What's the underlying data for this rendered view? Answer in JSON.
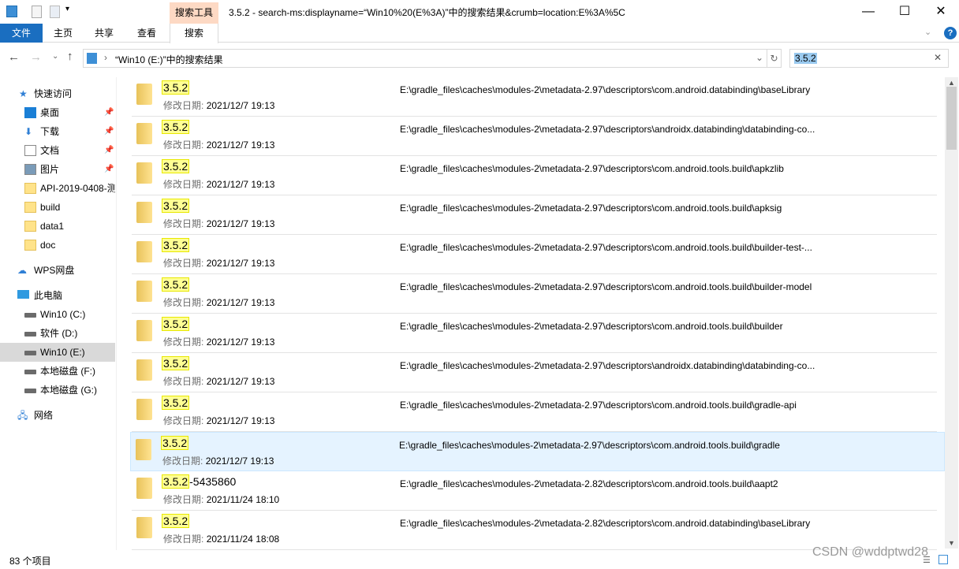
{
  "window": {
    "title": "3.5.2 - search-ms:displayname=“Win10%20(E%3A)”中的搜索结果&crumb=location:E%3A%5C",
    "context_tab": "搜索工具"
  },
  "ribbon": {
    "tabs": [
      "文件",
      "主页",
      "共享",
      "查看",
      "搜索"
    ]
  },
  "address": {
    "path": "“Win10 (E:)”中的搜索结果"
  },
  "search": {
    "value": "3.5.2"
  },
  "nav": {
    "quick_access": "快速访问",
    "items": [
      {
        "label": "桌面",
        "pinned": true
      },
      {
        "label": "下载",
        "pinned": true
      },
      {
        "label": "文档",
        "pinned": true
      },
      {
        "label": "图片",
        "pinned": true
      },
      {
        "label": "API-2019-0408-测"
      },
      {
        "label": "build"
      },
      {
        "label": "data1"
      },
      {
        "label": "doc"
      }
    ],
    "wps": "WPS网盘",
    "pc": "此电脑",
    "drives": [
      "Win10 (C:)",
      "软件 (D:)",
      "Win10 (E:)",
      "本地磁盘 (F:)",
      "本地磁盘 (G:)"
    ],
    "network": "网络"
  },
  "results": {
    "date_label": "修改日期:",
    "rows": [
      {
        "hl": "3.5.2",
        "rest": "",
        "date": "2021/12/7 19:13",
        "path": "E:\\gradle_files\\caches\\modules-2\\metadata-2.97\\descriptors\\com.android.databinding\\baseLibrary"
      },
      {
        "hl": "3.5.2",
        "rest": "",
        "date": "2021/12/7 19:13",
        "path": "E:\\gradle_files\\caches\\modules-2\\metadata-2.97\\descriptors\\androidx.databinding\\databinding-co..."
      },
      {
        "hl": "3.5.2",
        "rest": "",
        "date": "2021/12/7 19:13",
        "path": "E:\\gradle_files\\caches\\modules-2\\metadata-2.97\\descriptors\\com.android.tools.build\\apkzlib"
      },
      {
        "hl": "3.5.2",
        "rest": "",
        "date": "2021/12/7 19:13",
        "path": "E:\\gradle_files\\caches\\modules-2\\metadata-2.97\\descriptors\\com.android.tools.build\\apksig"
      },
      {
        "hl": "3.5.2",
        "rest": "",
        "date": "2021/12/7 19:13",
        "path": "E:\\gradle_files\\caches\\modules-2\\metadata-2.97\\descriptors\\com.android.tools.build\\builder-test-..."
      },
      {
        "hl": "3.5.2",
        "rest": "",
        "date": "2021/12/7 19:13",
        "path": "E:\\gradle_files\\caches\\modules-2\\metadata-2.97\\descriptors\\com.android.tools.build\\builder-model"
      },
      {
        "hl": "3.5.2",
        "rest": "",
        "date": "2021/12/7 19:13",
        "path": "E:\\gradle_files\\caches\\modules-2\\metadata-2.97\\descriptors\\com.android.tools.build\\builder"
      },
      {
        "hl": "3.5.2",
        "rest": "",
        "date": "2021/12/7 19:13",
        "path": "E:\\gradle_files\\caches\\modules-2\\metadata-2.97\\descriptors\\androidx.databinding\\databinding-co..."
      },
      {
        "hl": "3.5.2",
        "rest": "",
        "date": "2021/12/7 19:13",
        "path": "E:\\gradle_files\\caches\\modules-2\\metadata-2.97\\descriptors\\com.android.tools.build\\gradle-api"
      },
      {
        "hl": "3.5.2",
        "rest": "",
        "date": "2021/12/7 19:13",
        "path": "E:\\gradle_files\\caches\\modules-2\\metadata-2.97\\descriptors\\com.android.tools.build\\gradle",
        "hover": true
      },
      {
        "hl": "3.5.2",
        "rest": "-5435860",
        "date": "2021/11/24 18:10",
        "path": "E:\\gradle_files\\caches\\modules-2\\metadata-2.82\\descriptors\\com.android.tools.build\\aapt2"
      },
      {
        "hl": "3.5.2",
        "rest": "",
        "date": "2021/11/24 18:08",
        "path": "E:\\gradle_files\\caches\\modules-2\\metadata-2.82\\descriptors\\com.android.databinding\\baseLibrary"
      }
    ]
  },
  "status": {
    "count": "83 个项目"
  },
  "watermark": "CSDN @wddptwd28",
  "colors": {
    "file_tab": "#1a6ec0",
    "context_tab": "#fdd9c4",
    "highlight": "#ffff94",
    "hover_row": "#e5f3ff"
  }
}
